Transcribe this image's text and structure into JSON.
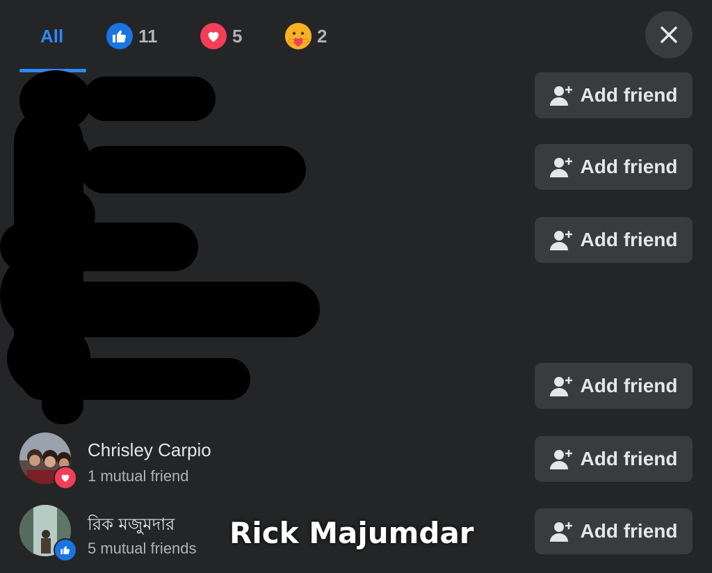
{
  "tabs": {
    "all": "All",
    "like_count": "11",
    "love_count": "5",
    "care_count": "2"
  },
  "add_friend_label": "Add friend",
  "people": [
    {
      "name": "Chrisley Carpio",
      "mutual": "1 mutual friend",
      "reaction": "love"
    },
    {
      "name": "রিক মজুমদার",
      "mutual": "5 mutual friends",
      "reaction": "like"
    }
  ],
  "caption": "Rick Majumdar",
  "colors": {
    "accent": "#2d88ff",
    "like": "#1b74e4",
    "love": "#f33e58",
    "care": "#f7b125",
    "background": "#242526",
    "button": "#3a3b3c"
  }
}
